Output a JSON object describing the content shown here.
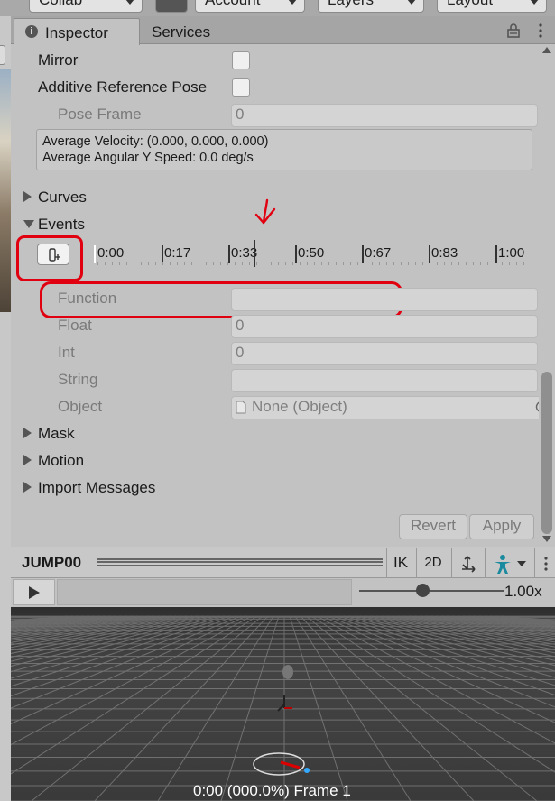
{
  "toolbar": {
    "collab_label": "Collab",
    "account_label": "Account",
    "layers_label": "Layers",
    "layout_label": "Layout"
  },
  "tabs": {
    "inspector": "Inspector",
    "services": "Services"
  },
  "fields": {
    "mirror_label": "Mirror",
    "additive_pose_label": "Additive Reference Pose",
    "pose_frame_label": "Pose Frame",
    "pose_frame_value": "0",
    "avg_velocity": "Average Velocity: (0.000, 0.000, 0.000)",
    "avg_angular": "Average Angular Y Speed: 0.0 deg/s"
  },
  "sections": {
    "curves": "Curves",
    "events": "Events",
    "mask": "Mask",
    "motion": "Motion",
    "import_messages": "Import Messages"
  },
  "timeline": {
    "ticks": [
      "0:00",
      "0:17",
      "0:33",
      "0:50",
      "0:67",
      "0:83",
      "1:00"
    ],
    "playhead_fraction": 0.39
  },
  "event_params": {
    "function_label": "Function",
    "function_value": "",
    "float_label": "Float",
    "float_value": "0",
    "int_label": "Int",
    "int_value": "0",
    "string_label": "String",
    "string_value": "",
    "object_label": "Object",
    "object_value": "None (Object)"
  },
  "buttons": {
    "revert": "Revert",
    "apply": "Apply"
  },
  "preview": {
    "clip_name": "JUMP00",
    "ik_label": "IK",
    "twod_label": "2D",
    "speed": "1.00x",
    "speed_fraction": 0.44,
    "frame_info": "0:00 (000.0%) Frame 1"
  },
  "colors": {
    "annotation_red": "#e00010",
    "inspector_bg": "#c2c2c2",
    "viewport_bg": "#3c3c3c"
  },
  "icons": [
    "info-icon",
    "lock-icon",
    "kebab-icon",
    "add-event-icon",
    "object-picker-icon",
    "move-tool-icon",
    "avatar-icon",
    "play-icon"
  ]
}
